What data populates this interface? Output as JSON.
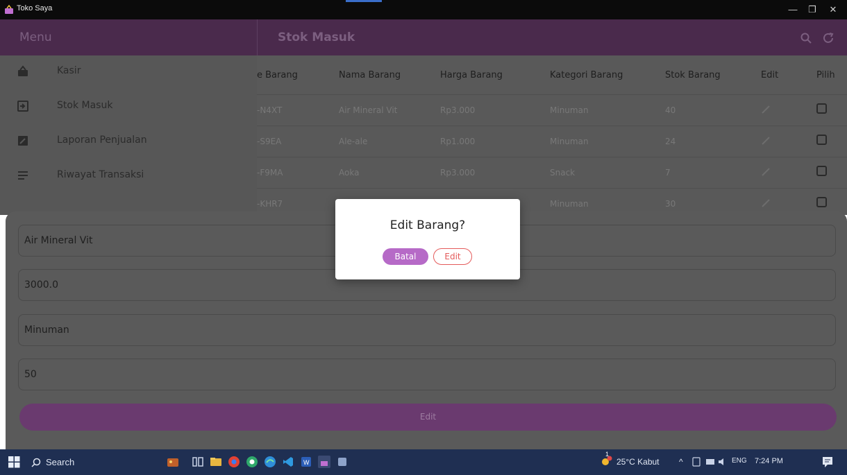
{
  "window": {
    "title": "Toko Saya",
    "minimize_glyph": "—",
    "maximize_glyph": "❐",
    "close_glyph": "✕"
  },
  "header": {
    "menu_title": "Menu",
    "page_title": "Stok Masuk",
    "icons": [
      "search-icon",
      "refresh-icon"
    ]
  },
  "drawer": {
    "items": [
      {
        "label": "Kasir",
        "icon": "basket-icon"
      },
      {
        "label": "Stok Masuk",
        "icon": "login-icon"
      },
      {
        "label": "Laporan Penjualan",
        "icon": "edit-note-icon"
      },
      {
        "label": "Riwayat Transaksi",
        "icon": "list-icon"
      }
    ]
  },
  "table": {
    "columns": [
      "e Barang",
      "Nama Barang",
      "Harga Barang",
      "Kategori Barang",
      "Stok Barang",
      "Edit",
      "Pilih"
    ],
    "rows": [
      {
        "kode": "-N4XT",
        "nama": "Air Mineral Vit",
        "harga": "Rp3.000",
        "kategori": "Minuman",
        "stok": "40"
      },
      {
        "kode": "-S9EA",
        "nama": "Ale-ale",
        "harga": "Rp1.000",
        "kategori": "Minuman",
        "stok": "24"
      },
      {
        "kode": "-F9MA",
        "nama": "Aoka",
        "harga": "Rp3.000",
        "kategori": "Snack",
        "stok": "7"
      },
      {
        "kode": "-KHR7",
        "nama": "",
        "harga": "",
        "kategori": "Minuman",
        "stok": "30"
      }
    ]
  },
  "form": {
    "nama": "Air Mineral Vit",
    "harga": "3000.0",
    "kategori": "Minuman",
    "stok": "50",
    "submit_label": "Edit"
  },
  "dialog": {
    "title": "Edit Barang?",
    "cancel_label": "Batal",
    "confirm_label": "Edit"
  },
  "taskbar": {
    "search_label": "Search",
    "weather": "25°C Kabut",
    "language": "ENG",
    "time": "7:24 PM",
    "notification_badge": "1"
  },
  "colors": {
    "header_purple": "#4a2a4c",
    "button_purple": "#b66ac7",
    "edit_red": "#e45a5a",
    "taskbar_blue": "#1f2f52"
  }
}
